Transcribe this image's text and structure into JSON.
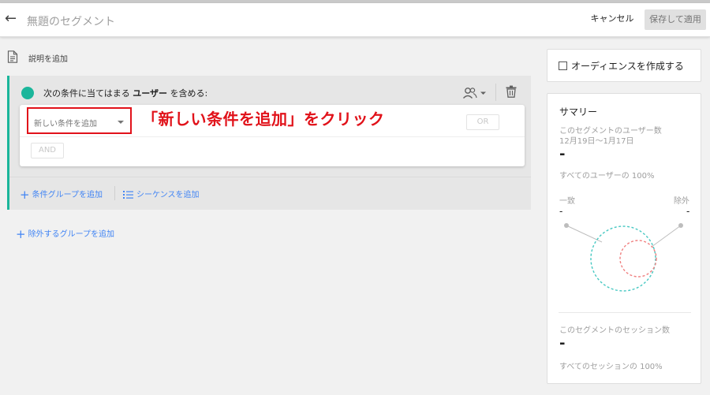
{
  "header": {
    "back_icon": "back-arrow-icon",
    "title": "無題のセグメント",
    "cancel_label": "キャンセル",
    "save_label": "保存して適用"
  },
  "description": {
    "icon": "document-icon",
    "link_label": "説明を追加"
  },
  "condition_group": {
    "heading_prefix": "次の条件に当てはまる",
    "heading_bold": "ユーザー",
    "heading_suffix": "を含める:",
    "scope_icon": "people-icon",
    "delete_icon": "trash-icon",
    "new_condition_placeholder": "新しい条件を追加",
    "or_label": "OR",
    "and_label": "AND",
    "add_condition_group_label": "条件グループを追加",
    "add_sequence_label": "シーケンスを追加"
  },
  "annotation": {
    "text": "「新しい条件を追加」をクリック",
    "color": "#e1121a"
  },
  "exclude_group_label": "除外するグループを追加",
  "audience": {
    "checkbox_label": "オーディエンスを作成する",
    "checked": false
  },
  "summary": {
    "title": "サマリー",
    "users_label": "このセグメントのユーザー数",
    "date_range": "12月19日～1月17日",
    "users_value": "-",
    "users_pct": "すべてのユーザーの 100%",
    "match_label": "一致",
    "exclude_label": "除外",
    "match_value": "-",
    "exclude_value": "-",
    "sessions_label": "このセグメントのセッション数",
    "sessions_value": "-",
    "sessions_pct": "すべてのセッションの 100%"
  },
  "colors": {
    "accent_teal": "#1bb69b",
    "link_blue": "#4285f4",
    "venn_match": "#47c8c2",
    "venn_exclude": "#f08080"
  }
}
